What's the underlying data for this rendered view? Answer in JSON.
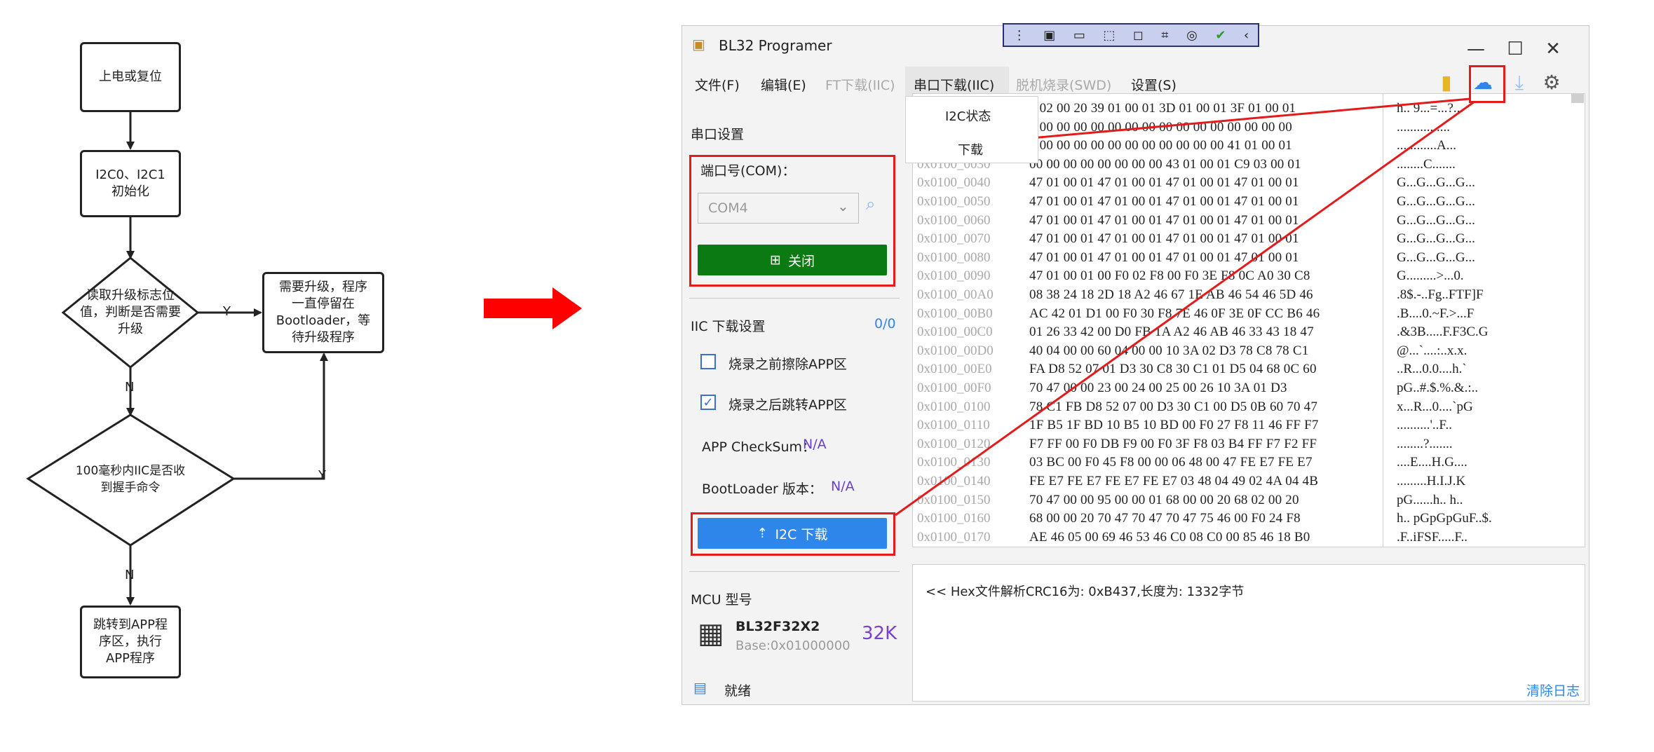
{
  "flowchart": {
    "nodes": {
      "start": "上电或复位",
      "init": "I2C0、I2C1\n初始化",
      "check_flag": "读取升级标志位\n值，判断是否需要\n升级",
      "wait_upgrade": "需要升级，程序\n一直停留在\nBootloader，等\n待升级程序",
      "check_cmd": "100毫秒内IIC是否收\n到握手命令",
      "jump_app": "跳转到APP程\n序区，执行\nAPP程序"
    },
    "edge_labels": {
      "yes": "Y",
      "no": "N"
    }
  },
  "window": {
    "title": "BL32 Programer",
    "menu": [
      "文件(F)",
      "编辑(E)",
      "FT下载(IIC)",
      "串口下载(IIC)",
      "脱机烧录(SWD)",
      "设置(S)"
    ],
    "dropdown": [
      "I2C状态",
      "下载"
    ],
    "serial_section": "串口设置",
    "com_label": "端口号(COM)：",
    "com_value": "COM4",
    "close_button": "关闭",
    "iic_section": "IIC 下载设置",
    "iic_count": "0/0",
    "erase_before": "烧录之前擦除APP区",
    "jump_after": "烧录之后跳转APP区",
    "checksum_label": "APP CheckSum：",
    "checksum_value": "N/A",
    "boot_label": "BootLoader 版本：",
    "boot_value": "N/A",
    "download_button": "I2C 下载",
    "mcu_section": "MCU 型号",
    "mcu_name": "BL32F32X2",
    "mcu_base": "Base:0x01000000",
    "mcu_size": "32K",
    "log_line": "<< Hex文件解析CRC16为: 0xB437,长度为: 1332字节",
    "status": "就绪",
    "clear_log": "清除日志",
    "accent": "#2f86ea",
    "close_btn_color": "#0c7a12"
  },
  "hex": [
    {
      "addr": "",
      "bytes": "8 02 00 20 39 01 00 01 3D 01 00 01 3F 01 00 01",
      "ascii": "h.. 9...=...?..."
    },
    {
      "addr": "",
      "bytes": "0 00 00 00 00 00 00 00 00 00 00 00 00 00 00 00",
      "ascii": "................"
    },
    {
      "addr": "",
      "bytes": "0 00 00 00 00 00 00 00 00 00 00 00 41 01 00 01",
      "ascii": "............A..."
    },
    {
      "addr": "0x0100_0030",
      "bytes": "00 00 00 00 00 00 00 00 43 01 00 01 C9 03 00 01",
      "ascii": "........C......."
    },
    {
      "addr": "0x0100_0040",
      "bytes": "47 01 00 01 47 01 00 01 47 01 00 01 47 01 00 01",
      "ascii": "G...G...G...G..."
    },
    {
      "addr": "0x0100_0050",
      "bytes": "47 01 00 01 47 01 00 01 47 01 00 01 47 01 00 01",
      "ascii": "G...G...G...G..."
    },
    {
      "addr": "0x0100_0060",
      "bytes": "47 01 00 01 47 01 00 01 47 01 00 01 47 01 00 01",
      "ascii": "G...G...G...G..."
    },
    {
      "addr": "0x0100_0070",
      "bytes": "47 01 00 01 47 01 00 01 47 01 00 01 47 01 00 01",
      "ascii": "G...G...G...G..."
    },
    {
      "addr": "0x0100_0080",
      "bytes": "47 01 00 01 47 01 00 01 47 01 00 01 47 01 00 01",
      "ascii": "G...G...G...G..."
    },
    {
      "addr": "0x0100_0090",
      "bytes": "47 01 00 01 00 F0 02 F8 00 F0 3E F8 0C A0 30 C8",
      "ascii": "G.........>...0."
    },
    {
      "addr": "0x0100_00A0",
      "bytes": "08 38 24 18 2D 18 A2 46 67 1E AB 46 54 46 5D 46",
      "ascii": ".8$.-..Fg..FTF]F"
    },
    {
      "addr": "0x0100_00B0",
      "bytes": "AC 42 01 D1 00 F0 30 F8 7E 46 0F 3E 0F CC B6 46",
      "ascii": ".B....0.~F.>...F"
    },
    {
      "addr": "0x0100_00C0",
      "bytes": "01 26 33 42 00 D0 FB 1A A2 46 AB 46 33 43 18 47",
      "ascii": ".&3B.....F.F3C.G"
    },
    {
      "addr": "0x0100_00D0",
      "bytes": "40 04 00 00 60 04 00 00 10 3A 02 D3 78 C8 78 C1",
      "ascii": "@...`....:..x.x."
    },
    {
      "addr": "0x0100_00E0",
      "bytes": "FA D8 52 07 01 D3 30 C8 30 C1 01 D5 04 68 0C 60",
      "ascii": "..R...0.0....h.`"
    },
    {
      "addr": "0x0100_00F0",
      "bytes": "70 47 00 00 23 00 24 00 25 00 26 10 3A 01 D3",
      "ascii": "pG..#.$.%.&.:.."
    },
    {
      "addr": "0x0100_0100",
      "bytes": "78 C1 FB D8 52 07 00 D3 30 C1 00 D5 0B 60 70 47",
      "ascii": "x...R...0....`pG"
    },
    {
      "addr": "0x0100_0110",
      "bytes": "1F B5 1F BD 10 B5 10 BD 00 F0 27 F8 11 46 FF F7",
      "ascii": "..........'..F.."
    },
    {
      "addr": "0x0100_0120",
      "bytes": "F7 FF 00 F0 DB F9 00 F0 3F F8 03 B4 FF F7 F2 FF",
      "ascii": "........?......."
    },
    {
      "addr": "0x0100_0130",
      "bytes": "03 BC 00 F0 45 F8 00 00 06 48 00 47 FE E7 FE E7",
      "ascii": "....E....H.G...."
    },
    {
      "addr": "0x0100_0140",
      "bytes": "FE E7 FE E7 FE E7 FE E7 03 48 04 49 02 4A 04 4B",
      "ascii": ".........H.I.J.K"
    },
    {
      "addr": "0x0100_0150",
      "bytes": "70 47 00 00 95 00 00 01 68 00 00 20 68 02 00 20",
      "ascii": "pG......h.. h.. "
    },
    {
      "addr": "0x0100_0160",
      "bytes": "68 00 00 20 70 47 70 47 70 47 75 46 00 F0 24 F8",
      "ascii": "h.. pGpGpGuF..$."
    },
    {
      "addr": "0x0100_0170",
      "bytes": "AE 46 05 00 69 46 53 46 C0 08 C0 00 85 46 18 B0",
      "ascii": ".F..iFSF.....F.."
    }
  ]
}
